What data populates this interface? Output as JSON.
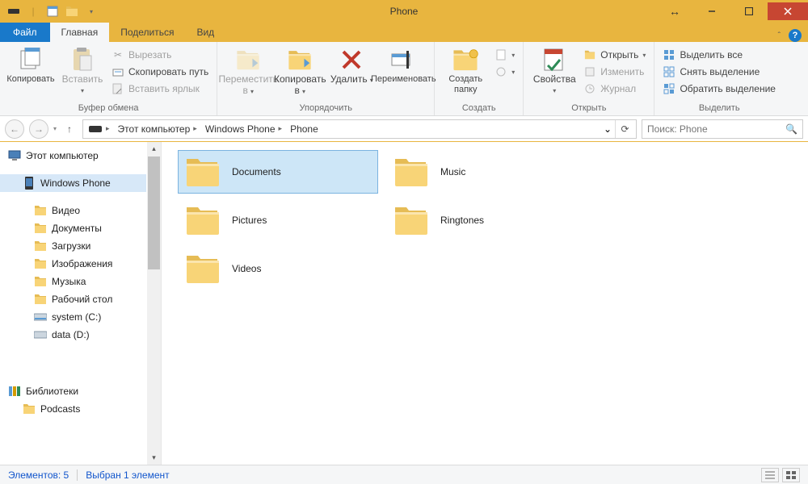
{
  "window": {
    "title": "Phone"
  },
  "menu": {
    "file": "Файл"
  },
  "tabs": {
    "home": "Главная",
    "share": "Поделиться",
    "view": "Вид"
  },
  "ribbon": {
    "clipboard": {
      "label": "Буфер обмена",
      "copy": "Копировать",
      "paste": "Вставить",
      "cut": "Вырезать",
      "copypath": "Скопировать путь",
      "pasteshortcut": "Вставить ярлык"
    },
    "organize": {
      "label": "Упорядочить",
      "moveto": "Переместить в",
      "copyto": "Копировать в",
      "delete": "Удалить",
      "rename": "Переименовать"
    },
    "new": {
      "label": "Создать",
      "newfolder": "Создать папку"
    },
    "open": {
      "label": "Открыть",
      "properties": "Свойства",
      "open": "Открыть",
      "edit": "Изменить",
      "history": "Журнал"
    },
    "select": {
      "label": "Выделить",
      "selectall": "Выделить все",
      "selectnone": "Снять выделение",
      "invert": "Обратить выделение"
    }
  },
  "breadcrumb": {
    "root": "Этот компьютер",
    "l1": "Windows Phone",
    "l2": "Phone"
  },
  "search": {
    "placeholder": "Поиск: Phone"
  },
  "sidebar": {
    "thispc": "Этот компьютер",
    "phone": "Windows Phone",
    "videos": "Видео",
    "documents": "Документы",
    "downloads": "Загрузки",
    "pictures": "Изображения",
    "music": "Музыка",
    "desktop": "Рабочий стол",
    "system": "system (C:)",
    "data": "data (D:)",
    "libraries": "Библиотеки",
    "podcasts": "Podcasts"
  },
  "files": {
    "documents": "Documents",
    "music": "Music",
    "pictures": "Pictures",
    "ringtones": "Ringtones",
    "videos": "Videos"
  },
  "status": {
    "count": "Элементов: 5",
    "selected": "Выбран 1 элемент"
  }
}
